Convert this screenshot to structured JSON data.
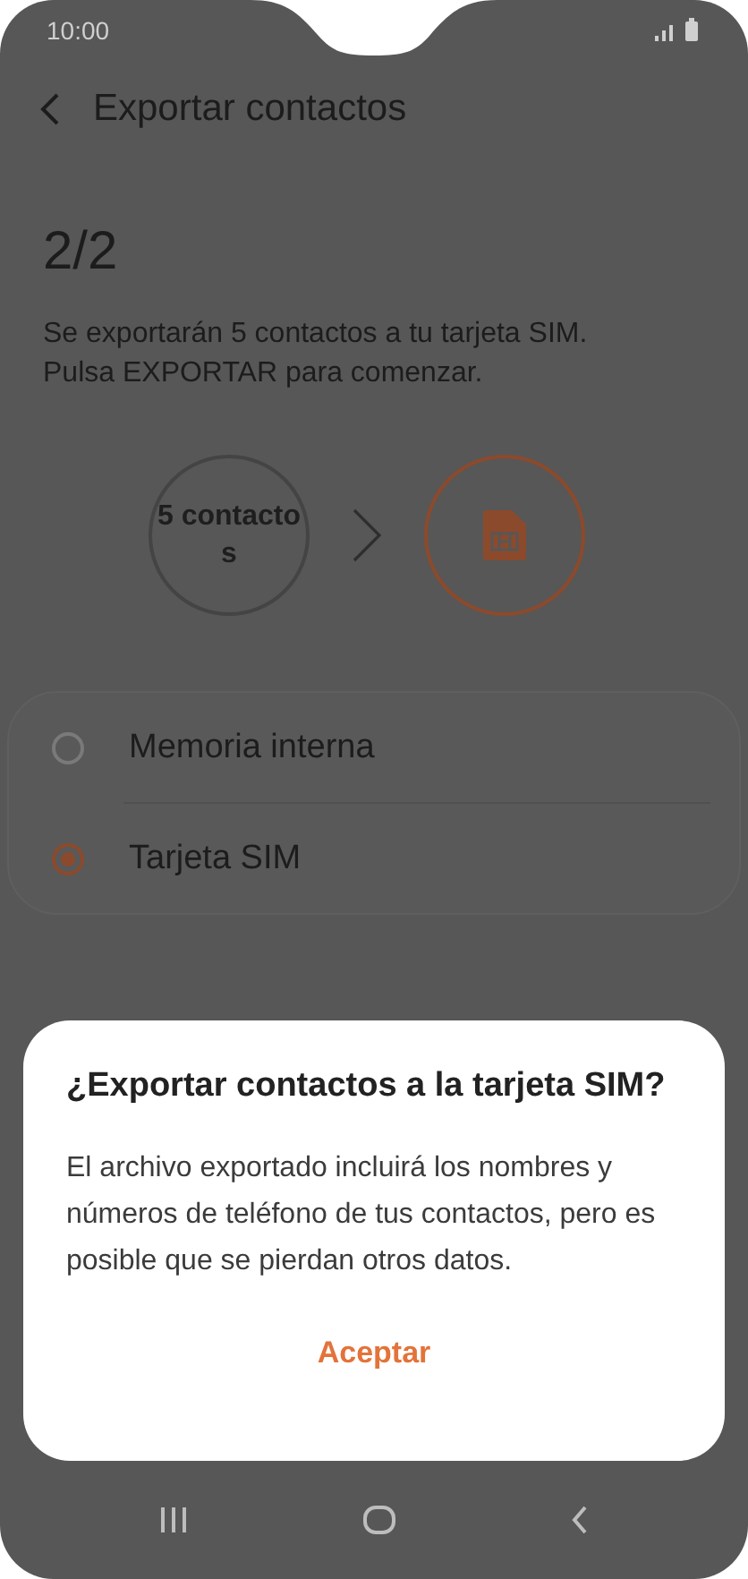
{
  "status_bar": {
    "time": "10:00"
  },
  "header": {
    "title": "Exportar contactos"
  },
  "step": "2/2",
  "description": "Se exportarán 5 contactos a tu tarjeta SIM. Pulsa EXPORTAR para comenzar.",
  "transfer": {
    "source": "5 contactos"
  },
  "options": [
    {
      "label": "Memoria interna",
      "selected": false
    },
    {
      "label": "Tarjeta SIM",
      "selected": true
    }
  ],
  "dialog": {
    "title": "¿Exportar contactos a la tarjeta SIM?",
    "message": "El archivo exportado incluirá los nombres y números de teléfono de tus contactos, pero es posible que se pierdan otros datos.",
    "button": "Aceptar"
  }
}
